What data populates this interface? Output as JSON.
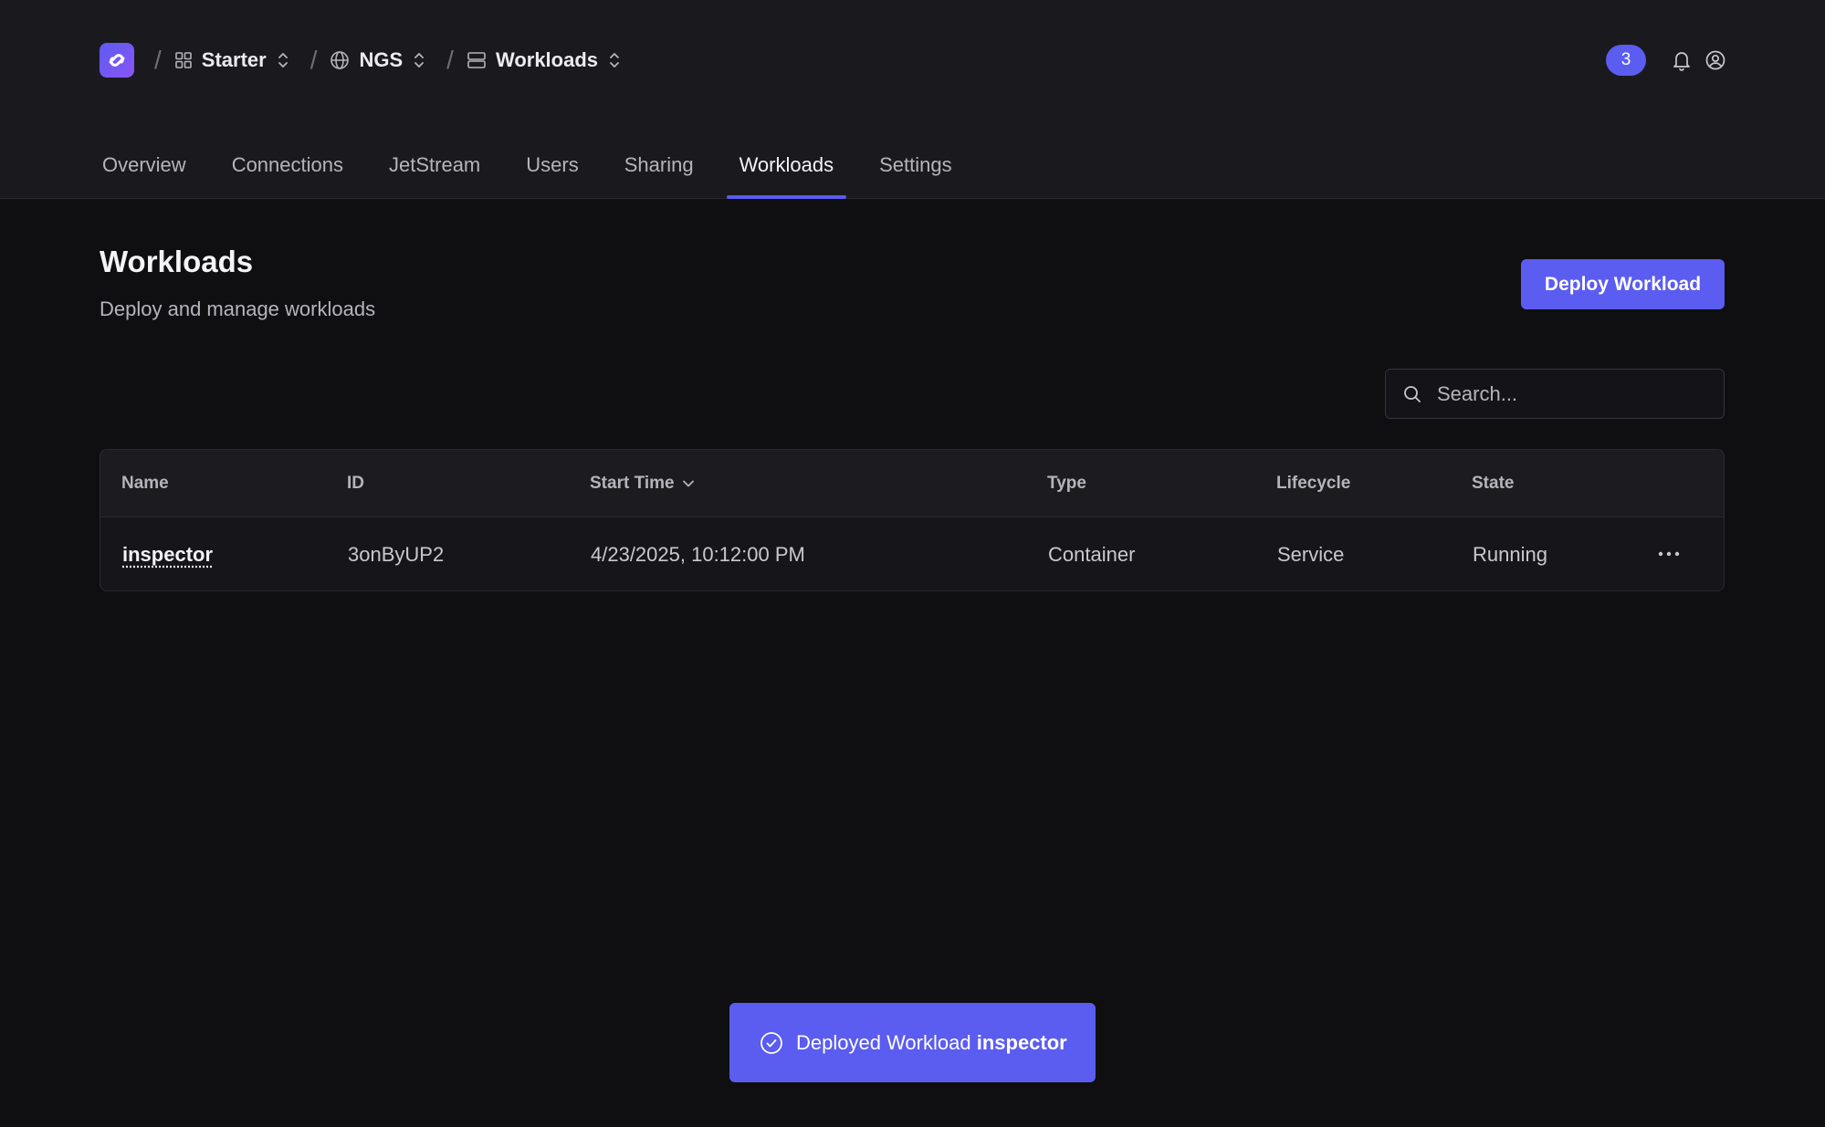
{
  "breadcrumb": {
    "items": [
      {
        "label": "Starter",
        "icon": "grid-icon"
      },
      {
        "label": "NGS",
        "icon": "globe-icon"
      },
      {
        "label": "Workloads",
        "icon": "server-icon"
      }
    ],
    "separator": "/"
  },
  "header": {
    "notification_count": "3"
  },
  "tabs": [
    {
      "label": "Overview"
    },
    {
      "label": "Connections"
    },
    {
      "label": "JetStream"
    },
    {
      "label": "Users"
    },
    {
      "label": "Sharing"
    },
    {
      "label": "Workloads",
      "active": true
    },
    {
      "label": "Settings"
    }
  ],
  "page": {
    "title": "Workloads",
    "subtitle": "Deploy and manage workloads",
    "deploy_label": "Deploy Workload"
  },
  "search": {
    "placeholder": "Search..."
  },
  "table": {
    "columns": [
      "Name",
      "ID",
      "Start Time",
      "Type",
      "Lifecycle",
      "State"
    ],
    "sorted_column": "Start Time",
    "rows": [
      {
        "name": "inspector",
        "id": "3onByUP2",
        "start_time": "4/23/2025, 10:12:00 PM",
        "type": "Container",
        "lifecycle": "Service",
        "state": "Running"
      }
    ]
  },
  "toast": {
    "prefix": "Deployed Workload",
    "workload": "inspector"
  },
  "colors": {
    "accent": "#5b5cf0",
    "background": "#0f0f12",
    "header_bg": "#1a1a1e"
  }
}
